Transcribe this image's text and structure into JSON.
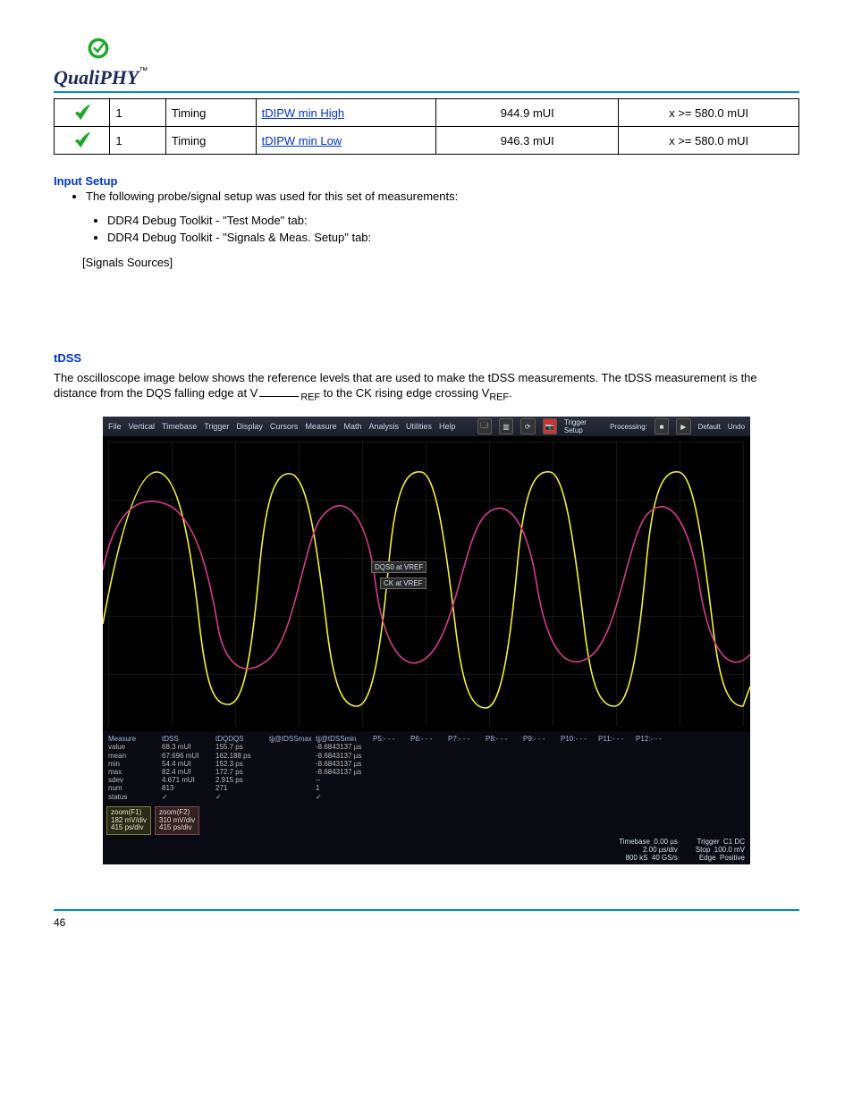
{
  "logo": {
    "text": "QualiPHY",
    "tm": "™"
  },
  "table_rows": [
    {
      "count": "1",
      "cat": "Timing",
      "name": "tDIPW min High",
      "value": "944.9 mUI",
      "limit": "x >= 580.0 mUI"
    },
    {
      "count": "1",
      "cat": "Timing",
      "name": "tDIPW min Low",
      "value": "946.3 mUI",
      "limit": "x >= 580.0 mUI"
    }
  ],
  "section_input": {
    "heading": "Input Setup",
    "bullets_top": [
      "The following probe/signal setup was used for this set of measurements:"
    ],
    "sub_bullets": [
      "DDR4 Debug Toolkit - \"Test Mode\" tab:",
      "DDR4 Debug Toolkit - \"Signals & Meas. Setup\" tab:"
    ],
    "signals_label": "[Signals Sources]"
  },
  "section_tdss": {
    "heading": "tDSS",
    "para": "The oscilloscope image below shows the reference levels that are used to make the tDSS measurements. The tDSS measurement is the distance from the DQS falling edge at V",
    "para_sub1": "REF",
    "para_mid": " to the CK rising edge crossing V",
    "para_sub2": "REF",
    "para_end": "."
  },
  "wave_labels": {
    "top": "DQS0 at VREF",
    "bottom": "CK at VREF"
  },
  "menubar": [
    "File",
    "Vertical",
    "Timebase",
    "Trigger",
    "Display",
    "Cursors",
    "Measure",
    "Math",
    "Analysis",
    "Utilities",
    "Help"
  ],
  "menu_right": {
    "trigger": "Trigger Setup",
    "processing": "Processing:",
    "default": "Default",
    "undo": "Undo"
  },
  "measure": {
    "headers": [
      "Measure",
      "tDSS",
      "tDQDQS",
      "tjj@tDSSmax",
      "tjj@tDSSmin",
      "P5:- - -",
      "P6:- - -",
      "P7:- - -",
      "P8:- - -",
      "P9:- - -",
      "P10:- - -",
      "P11:- - -",
      "P12:- - -"
    ],
    "rows": [
      [
        "value",
        "68.3 mUI",
        "155.7 ps",
        "",
        "-8.6843137 µs",
        "",
        "",
        "",
        "",
        "",
        "",
        "",
        ""
      ],
      [
        "mean",
        "67.696 mUI",
        "162.188 ps",
        "",
        "-8.6843137 µs",
        "",
        "",
        "",
        "",
        "",
        "",
        "",
        ""
      ],
      [
        "min",
        "54.4 mUI",
        "152.3 ps",
        "",
        "-8.6843137 µs",
        "",
        "",
        "",
        "",
        "",
        "",
        "",
        ""
      ],
      [
        "max",
        "82.4 mUI",
        "172.7 ps",
        "",
        "-8.6843137 µs",
        "",
        "",
        "",
        "",
        "",
        "",
        "",
        ""
      ],
      [
        "sdev",
        "4.671 mUI",
        "2.915 ps",
        "",
        "--",
        "",
        "",
        "",
        "",
        "",
        "",
        "",
        ""
      ],
      [
        "num",
        "813",
        "271",
        "",
        "1",
        "",
        "",
        "",
        "",
        "",
        "",
        "",
        ""
      ],
      [
        "status",
        "✓",
        "✓",
        "",
        "✓",
        "",
        "",
        "",
        "",
        "",
        "",
        "",
        ""
      ]
    ]
  },
  "zoom": [
    {
      "title": "zoom(F1)",
      "v": "182 mV/div",
      "t": "415 ps/div"
    },
    {
      "title": "zoom(F2)",
      "v": "310 mV/div",
      "t": "415 ps/div"
    }
  ],
  "footer_scope": {
    "timebase": {
      "label": "Timebase",
      "v1": "0.00 µs",
      "v2": "2.00 µs/div",
      "v3": "800 kS",
      "v4": "40 GS/s"
    },
    "trigger": {
      "label": "Trigger",
      "v1": "C1 DC",
      "v2": "Stop",
      "v3": "100.0 mV",
      "v4": "Edge",
      "v5": "Positive"
    }
  },
  "page_footer": "46"
}
